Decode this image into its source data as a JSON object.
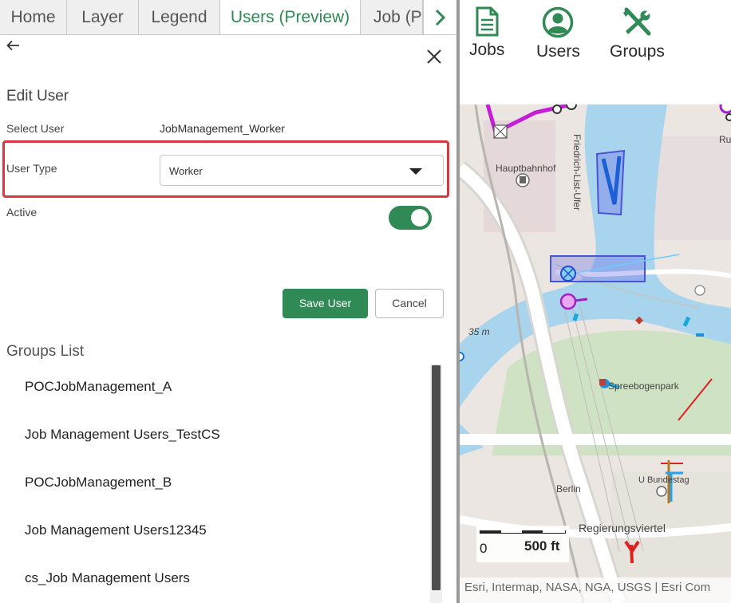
{
  "tabs": [
    {
      "label": "Home"
    },
    {
      "label": "Layer"
    },
    {
      "label": "Legend"
    },
    {
      "label": "Users (Preview)"
    },
    {
      "label": "Job (Pr"
    }
  ],
  "edit_user": {
    "title": "Edit User",
    "select_user_label": "Select User",
    "select_user_value": "JobManagement_Worker",
    "user_type_label": "User Type",
    "user_type_value": "Worker",
    "active_label": "Active",
    "active_on": true,
    "save_label": "Save User",
    "cancel_label": "Cancel"
  },
  "groups": {
    "title": "Groups List",
    "items": [
      "POCJobManagement_A",
      "Job Management Users_TestCS",
      "POCJobManagement_B",
      "Job Management Users12345",
      "cs_Job Management Users"
    ]
  },
  "toolbar": {
    "jobs_label": "Jobs",
    "users_label": "Users",
    "groups_label": "Groups"
  },
  "map": {
    "labels": {
      "hauptbahnhof": "Hauptbahnhof",
      "friedrich": "Friedrich-List-Ufer",
      "elevation": "35 m",
      "park": "Spreebogenpark",
      "berlin": "Berlin",
      "bundestag": "U Bundestag",
      "regierung": "Regierungsviertel",
      "ru": "Ru"
    },
    "scale": {
      "zero": "0",
      "max": "500 ft"
    },
    "attribution": "Esri, Intermap, NASA, NGA, USGS | Esri Com"
  },
  "colors": {
    "accent_green": "#2f8a55",
    "highlight_red": "#d9373f",
    "river": "#a8d4ee",
    "park": "#cfe3c4",
    "route_magenta": "#c41fd6",
    "feature_blue": "#2f5fd6"
  }
}
